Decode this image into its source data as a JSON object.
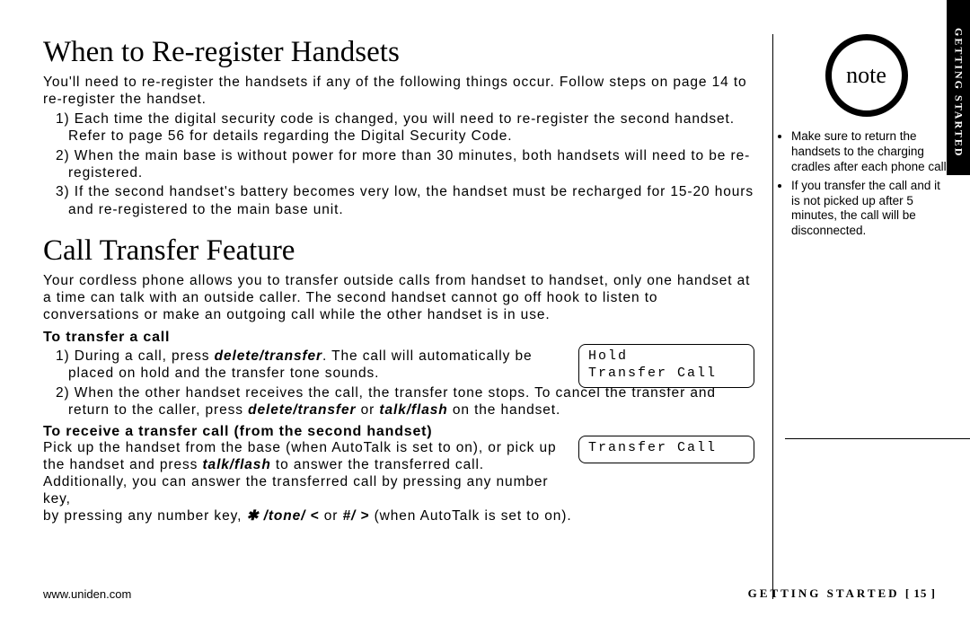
{
  "main": {
    "heading1": "When to Re-register Handsets",
    "intro1": "You'll need to re-register the handsets if any of the following things occur. Follow steps on page 14 to re-register the handset.",
    "list1": [
      "1) Each time the digital security code is changed, you will need to re-register the second handset. Refer to page 56 for details regarding the Digital Security Code.",
      "2) When the main base is without power for more than 30 minutes, both handsets will need to be re-registered.",
      "3) If the second handset's battery becomes very low, the handset must be recharged for 15-20 hours and re-registered to the main base unit."
    ],
    "heading2": "Call Transfer Feature",
    "intro2": "Your cordless phone allows you to transfer outside calls from handset to handset, only one handset at a time can talk with an outside caller. The second handset cannot go off hook to listen to conversations or make an outgoing call while the other handset is in use.",
    "subhead1": "To transfer a call",
    "t1_a": "1) During a call, press ",
    "t1_b": "delete/transfer",
    "t1_c": ". The call will automatically be placed on hold and the transfer tone sounds.",
    "t2_a": "2) When the other handset receives the call, the transfer tone stops. To cancel the transfer and return to the caller, press ",
    "t2_b": "delete/transfer",
    "t2_c": " or ",
    "t2_d": "talk/flash",
    "t2_e": " on the handset.",
    "subhead2": "To receive a transfer call (from the second handset)",
    "r1_a": "Pick up the handset from the base (when AutoTalk is set to on), or pick up the handset and press ",
    "r1_b": "talk/flash",
    "r1_c": " to answer the transferred call. Additionally, you can answer the transferred call by pressing any number key, ",
    "r1_d": "✱ /tone/ <",
    "r1_e": " or ",
    "r1_f": "#/ >",
    "r1_g": " (when AutoTalk is set to on).",
    "lcd1": "Hold\nTransfer Call",
    "lcd2": "Transfer Call"
  },
  "side": {
    "tab": "GETTING STARTED",
    "note_label": "note",
    "notes": [
      "Make sure to return the handsets to the charging cradles after each phone call.",
      "If you transfer the call and it is not picked up after 5 minutes, the call will be disconnected."
    ]
  },
  "footer": {
    "url": "www.uniden.com",
    "section": "GETTING STARTED",
    "page": "[ 15 ]"
  }
}
